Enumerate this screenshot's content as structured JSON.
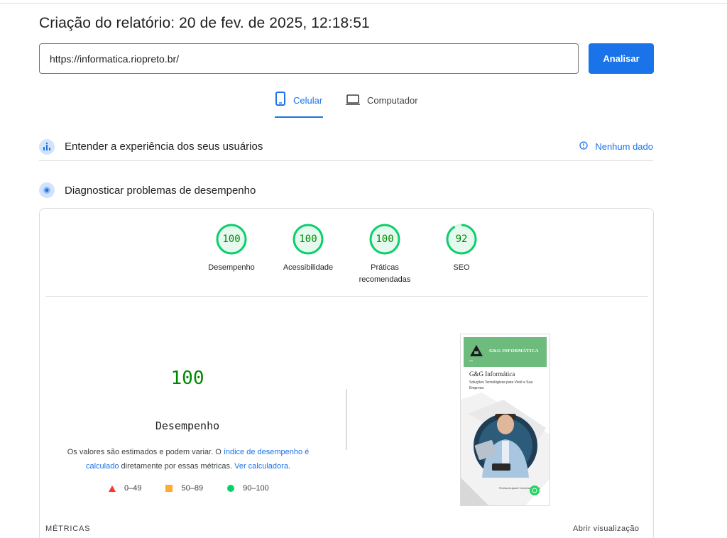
{
  "report": {
    "title": "Criação do relatório: 20 de fev. de 2025, 12:18:51"
  },
  "search": {
    "url": "https://informatica.riopreto.br/",
    "analyze_label": "Analisar"
  },
  "tabs": [
    {
      "label": "Celular",
      "active": true,
      "icon": "smartphone-icon"
    },
    {
      "label": "Computador",
      "active": false,
      "icon": "laptop-icon"
    }
  ],
  "ux_section": {
    "title": "Entender a experiência dos seus usuários",
    "status": "Nenhum dado",
    "icon": "people-chart-icon"
  },
  "diag_section": {
    "title": "Diagnosticar problemas de desempenho",
    "icon": "speedometer-icon"
  },
  "gauges": [
    {
      "score": "100",
      "label": "Desempenho"
    },
    {
      "score": "100",
      "label": "Acessibilidade"
    },
    {
      "score": "100",
      "label": "Práticas recomendadas"
    },
    {
      "score": "92",
      "label": "SEO"
    }
  ],
  "performance": {
    "score": "100",
    "label": "Desempenho",
    "desc_part1": "Os valores são estimados e podem variar. O ",
    "desc_link1": "índice de desempenho é calculado",
    "desc_part2": " diretamente por essas métricas. ",
    "desc_link2": "Ver calculadora."
  },
  "legend": [
    {
      "range": "0–49",
      "shape": "triangle",
      "color": "#ff3333"
    },
    {
      "range": "50–89",
      "shape": "square",
      "color": "#ffaa33"
    },
    {
      "range": "90–100",
      "shape": "circle",
      "color": "#0cce6b"
    }
  ],
  "metrics": {
    "header": "MÉTRICAS",
    "expand_label": "Abrir visualização"
  },
  "preview": {
    "brand": "G&G INFORMÁTICA",
    "title": "G&G Informática",
    "subtitle": "Soluções Tecnológicas para Você e Sua Empresa",
    "chat_text": "Precisa de ajuda? Converse conosco",
    "header_color": "#6dbb7d"
  },
  "colors": {
    "accent": "#1a73e8",
    "pass": "#0cce6b",
    "pass_text": "#008800"
  }
}
